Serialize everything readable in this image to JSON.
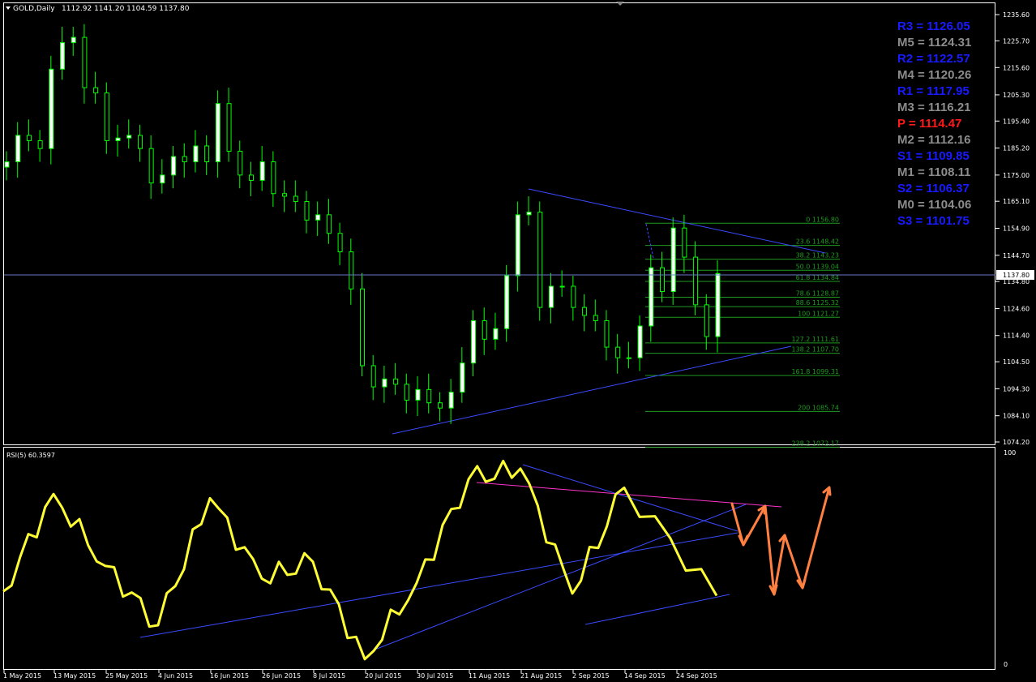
{
  "header": {
    "symbol": "GOLD,Daily",
    "ohlc": "1112.92 1141.20 1104.59 1137.80"
  },
  "current_price_label": "1137.80",
  "rsi_label": "RSI(5) 60.3597",
  "price_axis": [
    "1235.60",
    "1225.70",
    "1215.60",
    "1205.30",
    "1195.40",
    "1185.20",
    "1175.00",
    "1165.10",
    "1154.90",
    "1144.70",
    "1134.80",
    "1124.60",
    "1114.40",
    "1104.50",
    "1094.30",
    "1084.10",
    "1074.20"
  ],
  "rsi_axis": [
    "100",
    "0"
  ],
  "date_axis": [
    "1 May 2015",
    "13 May 2015",
    "25 May 2015",
    "4 Jun 2015",
    "16 Jun 2015",
    "26 Jun 2015",
    "8 Jul 2015",
    "20 Jul 2015",
    "30 Jul 2015",
    "11 Aug 2015",
    "21 Aug 2015",
    "2 Sep 2015",
    "14 Sep 2015",
    "24 Sep 2015"
  ],
  "pivots": [
    {
      "text": "R3 = 1126.05",
      "color": "#1a1aff"
    },
    {
      "text": "M5 = 1124.31",
      "color": "#8c8c8c"
    },
    {
      "text": "R2 = 1122.57",
      "color": "#1a1aff"
    },
    {
      "text": "M4 = 1120.26",
      "color": "#8c8c8c"
    },
    {
      "text": "R1 = 1117.95",
      "color": "#1a1aff"
    },
    {
      "text": "M3 = 1116.21",
      "color": "#8c8c8c"
    },
    {
      "text": "P   = 1114.47",
      "color": "#ff1a1a"
    },
    {
      "text": "M2 = 1112.16",
      "color": "#8c8c8c"
    },
    {
      "text": "S1 = 1109.85",
      "color": "#1a1aff"
    },
    {
      "text": "M1 = 1108.11",
      "color": "#8c8c8c"
    },
    {
      "text": "S2 = 1106.37",
      "color": "#1a1aff"
    },
    {
      "text": "M0 = 1104.06",
      "color": "#8c8c8c"
    },
    {
      "text": "S3 = 1101.75",
      "color": "#1a1aff"
    }
  ],
  "fib_levels": [
    {
      "label": "0 1156.80",
      "price": 1156.8
    },
    {
      "label": "23.6 1148.42",
      "price": 1148.42
    },
    {
      "label": "38.2 1143.23",
      "price": 1143.23
    },
    {
      "label": "50.0 1139.04",
      "price": 1139.04
    },
    {
      "label": "61.8 1134.84",
      "price": 1134.84
    },
    {
      "label": "78.6 1128.87",
      "price": 1128.87
    },
    {
      "label": "88.6 1125.32",
      "price": 1125.32
    },
    {
      "label": "100 1121.27",
      "price": 1121.27
    },
    {
      "label": "127.2 1111.61",
      "price": 1111.61
    },
    {
      "label": "138.2 1107.70",
      "price": 1107.7
    },
    {
      "label": "161.8 1099.31",
      "price": 1099.31
    },
    {
      "label": "200 1085.74",
      "price": 1085.74
    },
    {
      "label": "238.2 1072.17",
      "price": 1072.17
    }
  ],
  "colors": {
    "background": "#000000",
    "grid": "#ffffff",
    "candle": "#00ff00",
    "bull_body": "#ffffff",
    "trendline": "#3a4bff",
    "fib": "#1f9a1f",
    "rsi_line": "#ffff33",
    "rsi_trend_pink": "#ff33cc",
    "projection": "#ff8040"
  },
  "chart_data": [
    {
      "type": "candlestick",
      "title": "GOLD,Daily",
      "ylim": [
        1071.5,
        1240.0
      ],
      "close_axis_points": [
        [
          "2015-05-01",
          1180
        ],
        [
          "2015-05-05",
          1190
        ],
        [
          "2015-05-08",
          1188
        ],
        [
          "2015-05-11",
          1185
        ],
        [
          "2015-05-13",
          1215
        ],
        [
          "2015-05-15",
          1225
        ],
        [
          "2015-05-18",
          1227
        ],
        [
          "2015-05-20",
          1208
        ],
        [
          "2015-05-22",
          1206
        ],
        [
          "2015-05-26",
          1188
        ],
        [
          "2015-05-28",
          1189
        ],
        [
          "2015-06-01",
          1190
        ],
        [
          "2015-06-03",
          1185
        ],
        [
          "2015-06-05",
          1172
        ],
        [
          "2015-06-08",
          1175
        ],
        [
          "2015-06-10",
          1182
        ],
        [
          "2015-06-12",
          1180
        ],
        [
          "2015-06-15",
          1186
        ],
        [
          "2015-06-17",
          1180
        ],
        [
          "2015-06-19",
          1202
        ],
        [
          "2015-06-22",
          1184
        ],
        [
          "2015-06-24",
          1175
        ],
        [
          "2015-06-26",
          1173
        ],
        [
          "2015-06-29",
          1180
        ],
        [
          "2015-07-01",
          1168
        ],
        [
          "2015-07-03",
          1167
        ],
        [
          "2015-07-06",
          1165
        ],
        [
          "2015-07-08",
          1158
        ],
        [
          "2015-07-10",
          1160
        ],
        [
          "2015-07-13",
          1153
        ],
        [
          "2015-07-15",
          1146
        ],
        [
          "2015-07-17",
          1132
        ],
        [
          "2015-07-20",
          1103
        ],
        [
          "2015-07-22",
          1095
        ],
        [
          "2015-07-24",
          1098
        ],
        [
          "2015-07-27",
          1096
        ],
        [
          "2015-07-29",
          1090
        ],
        [
          "2015-07-31",
          1094
        ],
        [
          "2015-08-03",
          1089
        ],
        [
          "2015-08-05",
          1087
        ],
        [
          "2015-08-07",
          1093
        ],
        [
          "2015-08-10",
          1104
        ],
        [
          "2015-08-12",
          1120
        ],
        [
          "2015-08-14",
          1113
        ],
        [
          "2015-08-17",
          1117
        ],
        [
          "2015-08-19",
          1137
        ],
        [
          "2015-08-21",
          1160
        ],
        [
          "2015-08-24",
          1161
        ],
        [
          "2015-08-26",
          1125
        ],
        [
          "2015-08-28",
          1133
        ],
        [
          "2015-08-31",
          1133
        ],
        [
          "2015-09-02",
          1125
        ],
        [
          "2015-09-04",
          1122
        ],
        [
          "2015-09-07",
          1120
        ],
        [
          "2015-09-09",
          1110
        ],
        [
          "2015-09-11",
          1106
        ],
        [
          "2015-09-14",
          1106
        ],
        [
          "2015-09-16",
          1118
        ],
        [
          "2015-09-18",
          1140
        ],
        [
          "2015-09-21",
          1131
        ],
        [
          "2015-09-23",
          1155
        ],
        [
          "2015-09-25",
          1144
        ],
        [
          "2015-09-28",
          1126
        ],
        [
          "2015-09-30",
          1114
        ],
        [
          "2015-10-01",
          1137.8
        ]
      ]
    },
    {
      "type": "line",
      "title": "RSI(5) 60.3597",
      "ylim": [
        0,
        100
      ],
      "x": [
        "2015-05-01",
        "2015-05-13",
        "2015-05-25",
        "2015-06-04",
        "2015-06-16",
        "2015-06-26",
        "2015-07-08",
        "2015-07-20",
        "2015-07-30",
        "2015-08-11",
        "2015-08-21",
        "2015-09-02",
        "2015-09-14",
        "2015-09-24"
      ],
      "series": [
        {
          "values": [
            34,
            80,
            46,
            18,
            78,
            40,
            48,
            2,
            38,
            87,
            92,
            33,
            83,
            32
          ]
        }
      ]
    }
  ]
}
